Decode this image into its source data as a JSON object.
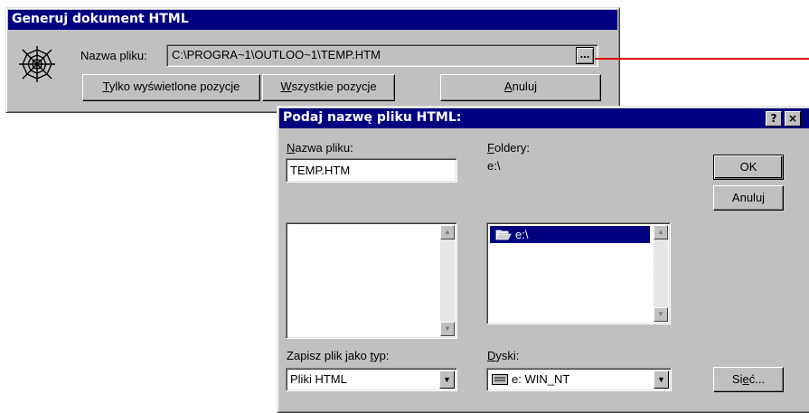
{
  "generate_dialog": {
    "title": "Generuj dokument HTML",
    "filename_label": "Nazwa pliku:",
    "filename_value": "C:\\PROGRA~1\\OUTLOO~1\\TEMP.HTM",
    "browse_label": "...",
    "btn_visible_prefix": "T",
    "btn_visible_rest": "ylko wyświetlone pozycje",
    "btn_all_prefix": "W",
    "btn_all_rest": "szystkie pozycje",
    "btn_cancel_prefix": "A",
    "btn_cancel_rest": "nuluj"
  },
  "save_dialog": {
    "title": "Podaj nazwę pliku HTML:",
    "help_label": "?",
    "close_label": "×",
    "filename_label_prefix": "N",
    "filename_label_rest": "azwa pliku:",
    "filename_value": "TEMP.HTM",
    "folders_label_prefix": "F",
    "folders_label_rest": "oldery:",
    "current_folder": "e:\\",
    "folder_items": [
      "e:\\"
    ],
    "filetype_label_prefix": "Zapisz plik jako ",
    "filetype_label_u": "t",
    "filetype_label_rest": "yp:",
    "filetype_value": "Pliki HTML",
    "drives_label_prefix": "D",
    "drives_label_rest": "yski:",
    "drive_value": "e: WIN_NT",
    "ok_label": "OK",
    "cancel_label": "Anuluj",
    "network_label_prefix": "Si",
    "network_label_u": "e",
    "network_label_rest": "ć..."
  },
  "colors": {
    "titlebar": "#000080",
    "face": "#c0c0c0",
    "pointer_line": "#e00000"
  }
}
